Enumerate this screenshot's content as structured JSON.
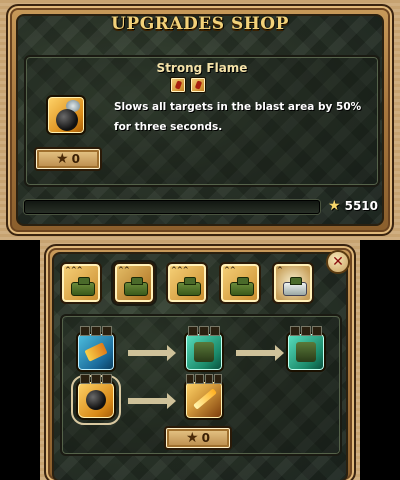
{
  "shop": {
    "title": "UPGRADES SHOP",
    "item_name": "Strong Flame",
    "description": "Slows all targets in the blast area by 50% for three seconds.",
    "price_label": "0",
    "star_glyph": "★",
    "coins_value": "5510"
  },
  "tabs": [
    {
      "icon": "tank-unit-icon",
      "rank": "^^^"
    },
    {
      "icon": "soldier-unit-icon",
      "rank": "^^"
    },
    {
      "icon": "tank-unit-icon",
      "rank": "^^^"
    },
    {
      "icon": "artillery-unit-icon",
      "rank": "^^"
    },
    {
      "icon": "medic-unit-icon",
      "rank": "^"
    }
  ],
  "upgrade_tree": {
    "price_label": "0",
    "nodes": [
      {
        "icon": "rocket-upgrade-icon",
        "color": "#1a6a9a"
      },
      {
        "icon": "troops-upgrade-icon",
        "color": "#1a8a6a"
      },
      {
        "icon": "troops-upgrade-icon",
        "color": "#1a8a6a"
      },
      {
        "icon": "bomb-upgrade-icon",
        "color": "#d98a18"
      },
      {
        "icon": "flame-upgrade-icon",
        "color": "#d98a18"
      }
    ]
  },
  "close_glyph": "✕",
  "colors": {
    "title_gold": "#f2d27a",
    "wood_frame": "#a8773e",
    "camo_dark": "#2a3428"
  }
}
